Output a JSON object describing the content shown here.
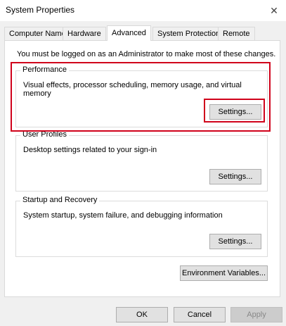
{
  "window": {
    "title": "System Properties",
    "close_glyph": "✕"
  },
  "tabs": [
    {
      "label": "Computer Name"
    },
    {
      "label": "Hardware"
    },
    {
      "label": "Advanced",
      "active": true
    },
    {
      "label": "System Protection"
    },
    {
      "label": "Remote"
    }
  ],
  "admin_note": "You must be logged on as an Administrator to make most of these changes.",
  "performance": {
    "title": "Performance",
    "description": "Visual effects, processor scheduling, memory usage, and virtual memory",
    "button": "Settings..."
  },
  "user_profiles": {
    "title": "User Profiles",
    "description": "Desktop settings related to your sign-in",
    "button": "Settings..."
  },
  "startup_recovery": {
    "title": "Startup and Recovery",
    "description": "System startup, system failure, and debugging information",
    "button": "Settings..."
  },
  "env_button": "Environment Variables...",
  "footer": {
    "ok": "OK",
    "cancel": "Cancel",
    "apply": "Apply"
  },
  "colors": {
    "highlight": "#d0021b",
    "active_tab": "#ffffff",
    "window_bg": "#f0f0f0"
  }
}
